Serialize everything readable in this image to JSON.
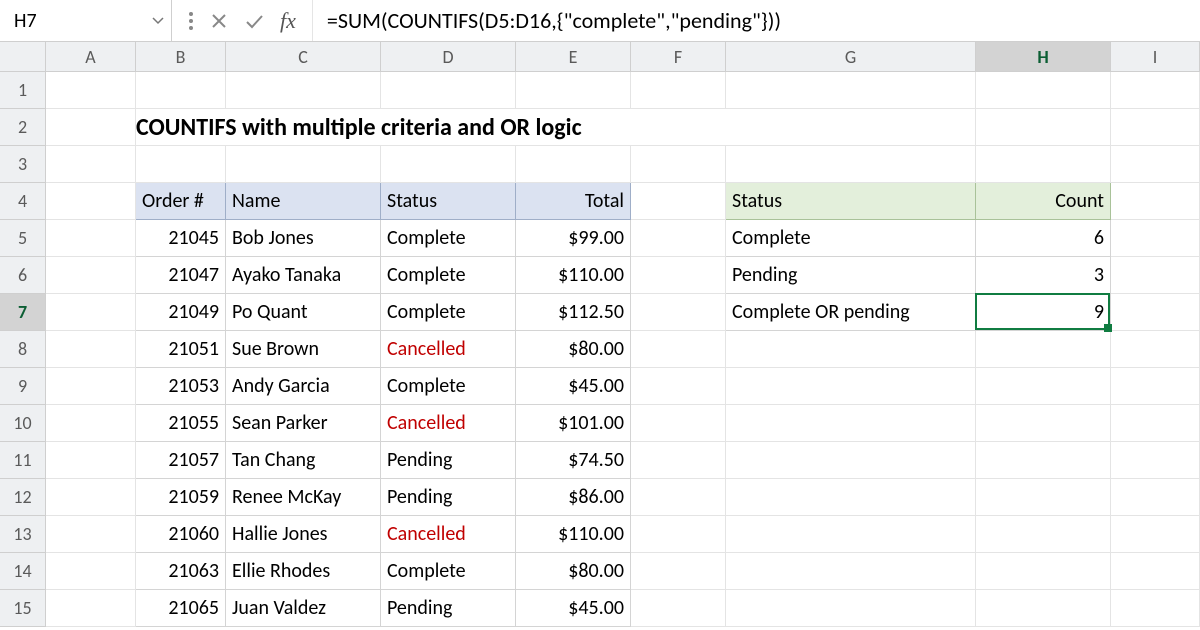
{
  "namebox": "H7",
  "formula": "=SUM(COUNTIFS(D5:D16,{\"complete\",\"pending\"}))",
  "columns": [
    "",
    "A",
    "B",
    "C",
    "D",
    "E",
    "F",
    "G",
    "H",
    "I"
  ],
  "selected_col_idx": 8,
  "rows": [
    "1",
    "2",
    "3",
    "4",
    "5",
    "6",
    "7",
    "8",
    "9",
    "10",
    "11",
    "12",
    "13",
    "14",
    "15"
  ],
  "selected_row_idx": 6,
  "title": "COUNTIFS with multiple criteria and OR logic",
  "table": {
    "headers": [
      "Order #",
      "Name",
      "Status",
      "Total"
    ],
    "rows": [
      {
        "order": "21045",
        "name": "Bob Jones",
        "status": "Complete",
        "total": "$99.00"
      },
      {
        "order": "21047",
        "name": "Ayako Tanaka",
        "status": "Complete",
        "total": "$110.00"
      },
      {
        "order": "21049",
        "name": "Po Quant",
        "status": "Complete",
        "total": "$112.50"
      },
      {
        "order": "21051",
        "name": "Sue Brown",
        "status": "Cancelled",
        "total": "$80.00"
      },
      {
        "order": "21053",
        "name": "Andy Garcia",
        "status": "Complete",
        "total": "$45.00"
      },
      {
        "order": "21055",
        "name": "Sean Parker",
        "status": "Cancelled",
        "total": "$101.00"
      },
      {
        "order": "21057",
        "name": "Tan Chang",
        "status": "Pending",
        "total": "$74.50"
      },
      {
        "order": "21059",
        "name": "Renee McKay",
        "status": "Pending",
        "total": "$86.00"
      },
      {
        "order": "21060",
        "name": "Hallie Jones",
        "status": "Cancelled",
        "total": "$110.00"
      },
      {
        "order": "21063",
        "name": "Ellie Rhodes",
        "status": "Complete",
        "total": "$80.00"
      },
      {
        "order": "21065",
        "name": "Juan Valdez",
        "status": "Pending",
        "total": "$45.00"
      }
    ]
  },
  "summary": {
    "headers": [
      "Status",
      "Count"
    ],
    "rows": [
      {
        "status": "Complete",
        "count": "6"
      },
      {
        "status": "Pending",
        "count": "3"
      },
      {
        "status": "Complete OR pending",
        "count": "9"
      }
    ]
  },
  "cancelled_value": "Cancelled",
  "colors": {
    "accent": "#107c41",
    "cancelled": "#c00000"
  }
}
